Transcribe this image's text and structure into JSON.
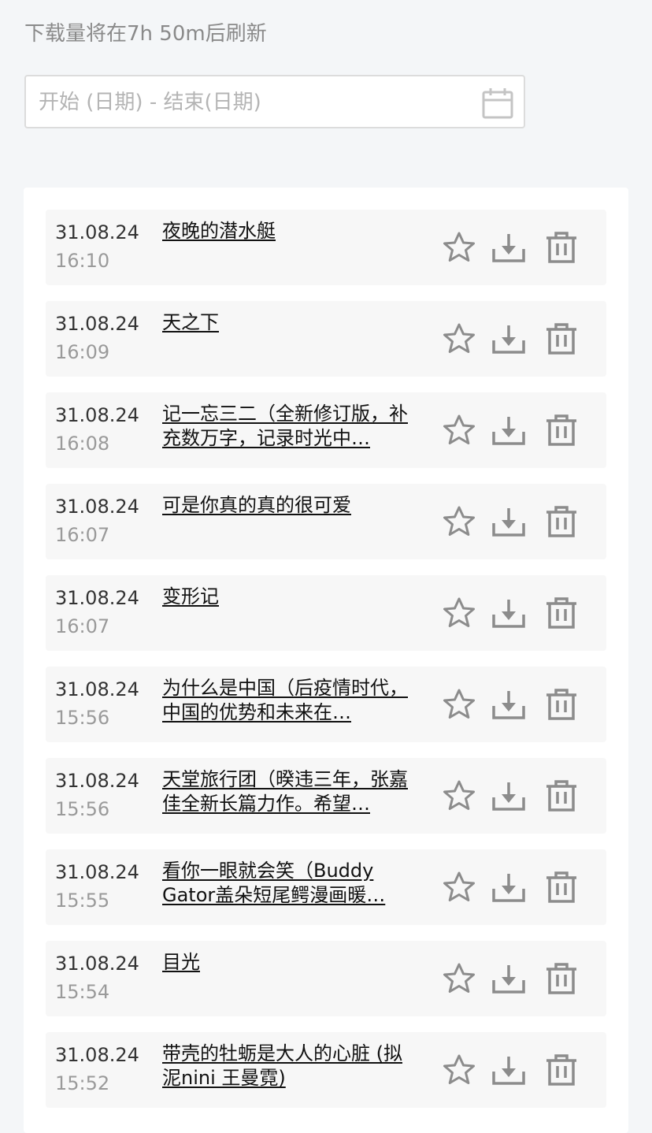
{
  "header": {
    "refresh_note": "下载量将在7h 50m后刷新"
  },
  "date_filter": {
    "placeholder": "开始 (日期) - 结束(日期)",
    "icon": "calendar-icon"
  },
  "actions": {
    "favorite_icon": "star-icon",
    "download_icon": "download-icon",
    "delete_icon": "trash-icon"
  },
  "colors": {
    "icon_gray": "#8c8c8c",
    "row_background": "#f7f7f7",
    "page_background": "#f4f6f8"
  },
  "downloads": [
    {
      "date": "31.08.24",
      "time": "16:10",
      "title": "夜晚的潜水艇"
    },
    {
      "date": "31.08.24",
      "time": "16:09",
      "title": "天之下"
    },
    {
      "date": "31.08.24",
      "time": "16:08",
      "title": "记一忘三二（全新修订版，补充数万字，记录时光中…"
    },
    {
      "date": "31.08.24",
      "time": "16:07",
      "title": "可是你真的真的很可爱"
    },
    {
      "date": "31.08.24",
      "time": "16:07",
      "title": "变形记"
    },
    {
      "date": "31.08.24",
      "time": "15:56",
      "title": "为什么是中国（后疫情时代，中国的优势和未来在…"
    },
    {
      "date": "31.08.24",
      "time": "15:56",
      "title": "天堂旅行团（暌违三年，张嘉佳全新长篇力作。希望…"
    },
    {
      "date": "31.08.24",
      "time": "15:55",
      "title": "看你一眼就会笑（Buddy Gator盖朵短尾鳄漫画暖…"
    },
    {
      "date": "31.08.24",
      "time": "15:54",
      "title": "目光"
    },
    {
      "date": "31.08.24",
      "time": "15:52",
      "title": "带壳的牡蛎是大人的心脏 (拟泥nini 王曼霓)"
    }
  ]
}
